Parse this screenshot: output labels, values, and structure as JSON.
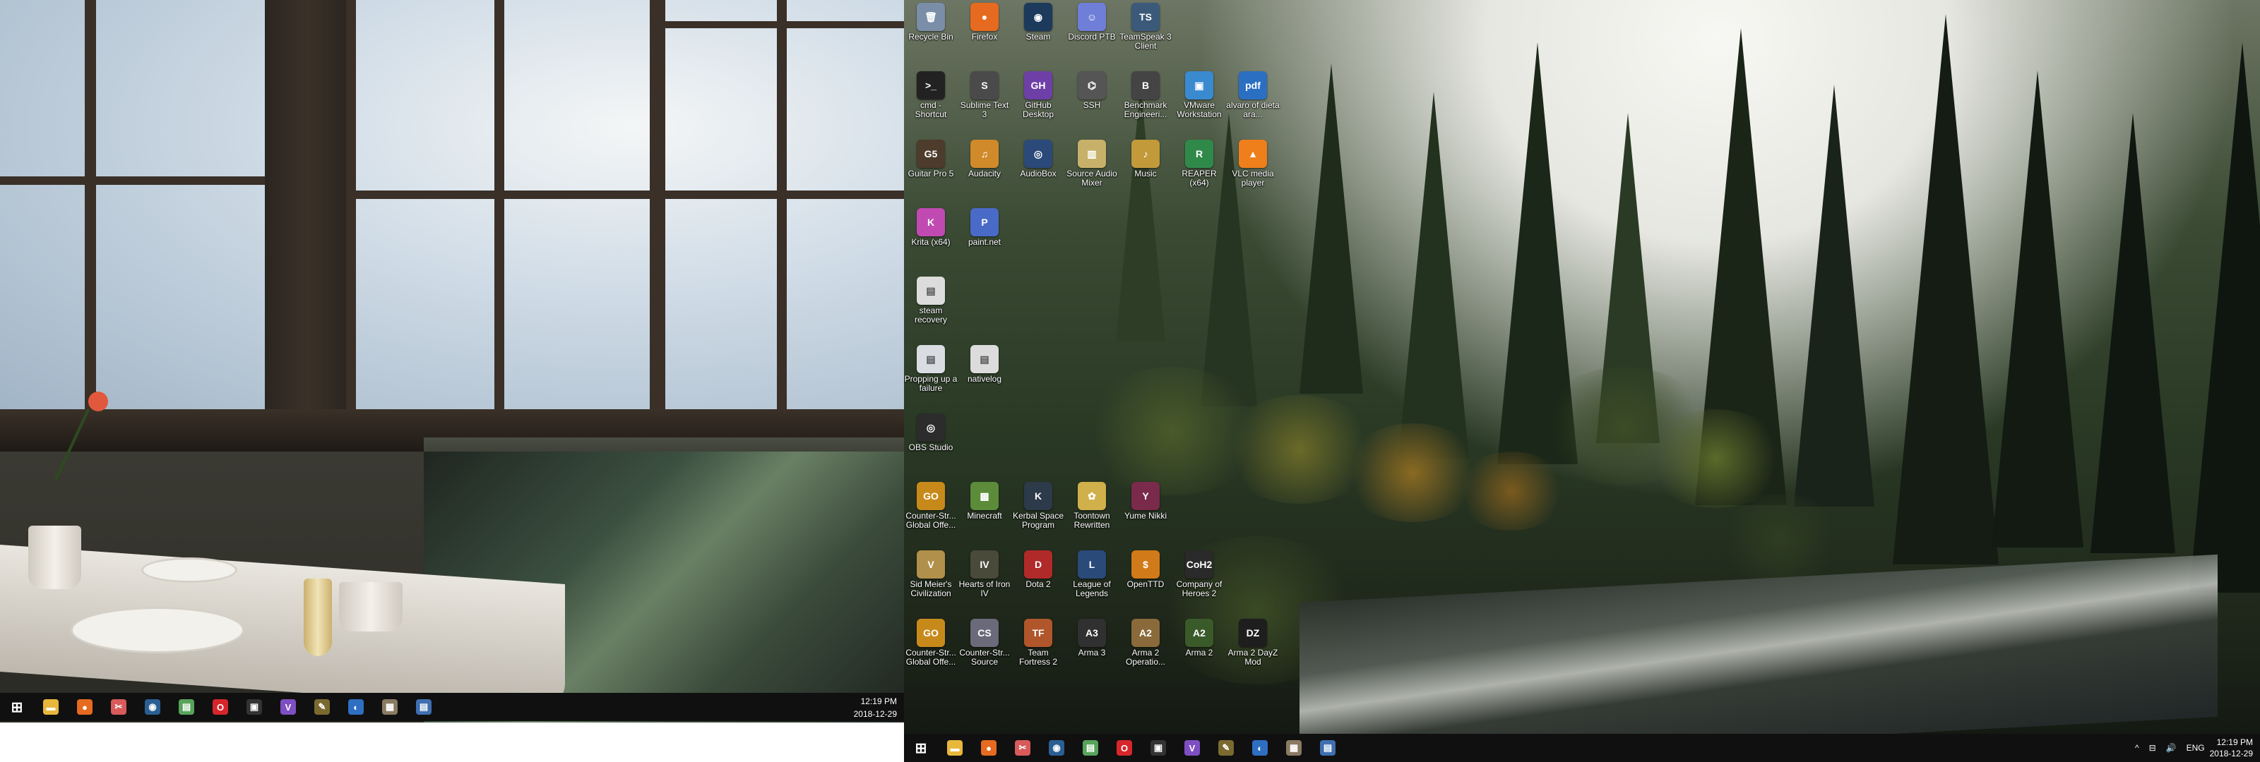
{
  "left_monitor": {
    "taskbar": {
      "items": [
        {
          "name": "start-button",
          "glyph": "⊞",
          "color": "#ffffff"
        },
        {
          "name": "file-explorer-icon",
          "glyph": "▬",
          "color": "#e8b83c"
        },
        {
          "name": "firefox-icon",
          "glyph": "●",
          "color": "#e66a1f"
        },
        {
          "name": "snipping-tool-icon",
          "glyph": "✂",
          "color": "#d85a5a"
        },
        {
          "name": "steam-icon",
          "glyph": "◉",
          "color": "#2a5f93"
        },
        {
          "name": "notepad-icon",
          "glyph": "▤",
          "color": "#57a35a"
        },
        {
          "name": "opera-icon",
          "glyph": "O",
          "color": "#d6262b"
        },
        {
          "name": "terminal-icon",
          "glyph": "▣",
          "color": "#333333"
        },
        {
          "name": "visual-studio-icon",
          "glyph": "V",
          "color": "#7e4fc2"
        },
        {
          "name": "paint-tool-icon",
          "glyph": "✎",
          "color": "#7a6a30"
        },
        {
          "name": "dot-app-icon",
          "glyph": "◐",
          "color": "#2f6fc2"
        },
        {
          "name": "gallery-icon",
          "glyph": "▦",
          "color": "#8a7a62"
        },
        {
          "name": "document-icon",
          "glyph": "▤",
          "color": "#3f6fb0"
        }
      ],
      "clock_time": "12:19 PM",
      "clock_date": "2018-12-29"
    }
  },
  "right_monitor": {
    "desktop_icons": [
      {
        "label": "Recycle Bin",
        "glyph": "🗑",
        "color": "#7a8ea8",
        "col": 0,
        "row": 0
      },
      {
        "label": "Firefox",
        "glyph": "●",
        "color": "#e66a1f",
        "col": 1,
        "row": 0
      },
      {
        "label": "Steam",
        "glyph": "◉",
        "color": "#1b3a5c",
        "col": 2,
        "row": 0
      },
      {
        "label": "Discord PTB",
        "glyph": "☺",
        "color": "#6f7fd8",
        "col": 3,
        "row": 0
      },
      {
        "label": "TeamSpeak 3 Client",
        "glyph": "TS",
        "color": "#3b5a7a",
        "col": 4,
        "row": 0
      },
      {
        "label": "cmd - Shortcut",
        "glyph": ">_",
        "color": "#222222",
        "col": 0,
        "row": 1
      },
      {
        "label": "Sublime Text 3",
        "glyph": "S",
        "color": "#4a4a4a",
        "col": 1,
        "row": 1
      },
      {
        "label": "GitHub Desktop",
        "glyph": "GH",
        "color": "#6e3fa7",
        "col": 2,
        "row": 1
      },
      {
        "label": "SSH",
        "glyph": "⌬",
        "color": "#555555",
        "col": 3,
        "row": 1
      },
      {
        "label": "Benchmark Engineeri...",
        "glyph": "B",
        "color": "#444444",
        "col": 4,
        "row": 1
      },
      {
        "label": "VMware Workstation",
        "glyph": "▣",
        "color": "#3a8ad0",
        "col": 5,
        "row": 1
      },
      {
        "label": "alvaro of dieta ara...",
        "glyph": "pdf",
        "color": "#2a6fc2",
        "col": 6,
        "row": 1
      },
      {
        "label": "Guitar Pro 5",
        "glyph": "G5",
        "color": "#4d3b2b",
        "col": 0,
        "row": 2
      },
      {
        "label": "Audacity",
        "glyph": "♫",
        "color": "#d08a2a",
        "col": 1,
        "row": 2
      },
      {
        "label": "AudioBox",
        "glyph": "◎",
        "color": "#2b4a7a",
        "col": 2,
        "row": 2
      },
      {
        "label": "Source Audio Mixer",
        "glyph": "▥",
        "color": "#c7b16a",
        "col": 3,
        "row": 2
      },
      {
        "label": "Music",
        "glyph": "♪",
        "color": "#c29a3a",
        "col": 4,
        "row": 2
      },
      {
        "label": "REAPER (x64)",
        "glyph": "R",
        "color": "#2f8a4a",
        "col": 5,
        "row": 2
      },
      {
        "label": "VLC media player",
        "glyph": "▲",
        "color": "#ee7f1a",
        "col": 6,
        "row": 2
      },
      {
        "label": "Krita (x64)",
        "glyph": "K",
        "color": "#c04ab2",
        "col": 0,
        "row": 3
      },
      {
        "label": "paint.net",
        "glyph": "P",
        "color": "#4a6ac8",
        "col": 1,
        "row": 3
      },
      {
        "label": "steam recovery",
        "glyph": "▤",
        "color": "#dcdcdc",
        "col": 0,
        "row": 4
      },
      {
        "label": "Propping up a failure",
        "glyph": "▤",
        "color": "#d9dde2",
        "col": 0,
        "row": 5
      },
      {
        "label": "nativelog",
        "glyph": "▤",
        "color": "#dcdcdc",
        "col": 1,
        "row": 5
      },
      {
        "label": "OBS Studio",
        "glyph": "◎",
        "color": "#2c2c2c",
        "col": 0,
        "row": 6
      },
      {
        "label": "Counter-Str... Global Offe...",
        "glyph": "GO",
        "color": "#c78a1a",
        "col": 0,
        "row": 7
      },
      {
        "label": "Minecraft",
        "glyph": "▩",
        "color": "#5c8c3a",
        "col": 1,
        "row": 7
      },
      {
        "label": "Kerbal Space Program",
        "glyph": "K",
        "color": "#2c3a4a",
        "col": 2,
        "row": 7
      },
      {
        "label": "Toontown Rewritten",
        "glyph": "✿",
        "color": "#d0b04a",
        "col": 3,
        "row": 7
      },
      {
        "label": "Yume Nikki",
        "glyph": "Y",
        "color": "#7a2a4a",
        "col": 4,
        "row": 7
      },
      {
        "label": "Sid Meier's Civilization",
        "glyph": "V",
        "color": "#b0904a",
        "col": 0,
        "row": 8
      },
      {
        "label": "Hearts of Iron IV",
        "glyph": "IV",
        "color": "#4a4a3a",
        "col": 1,
        "row": 8
      },
      {
        "label": "Dota 2",
        "glyph": "D",
        "color": "#b02a2a",
        "col": 2,
        "row": 8
      },
      {
        "label": "League of Legends",
        "glyph": "L",
        "color": "#2a4a7a",
        "col": 3,
        "row": 8
      },
      {
        "label": "OpenTTD",
        "glyph": "$",
        "color": "#d07a1a",
        "col": 4,
        "row": 8
      },
      {
        "label": "Company of Heroes 2",
        "glyph": "CoH2",
        "color": "#2a2a2a",
        "col": 5,
        "row": 8
      },
      {
        "label": "Counter-Str... Global Offe...",
        "glyph": "GO",
        "color": "#c78a1a",
        "col": 0,
        "row": 9
      },
      {
        "label": "Counter-Str... Source",
        "glyph": "CS",
        "color": "#6a6a7a",
        "col": 1,
        "row": 9
      },
      {
        "label": "Team Fortress 2",
        "glyph": "TF",
        "color": "#b0562a",
        "col": 2,
        "row": 9
      },
      {
        "label": "Arma 3",
        "glyph": "A3",
        "color": "#303030",
        "col": 3,
        "row": 9
      },
      {
        "label": "Arma 2 Operatio...",
        "glyph": "A2",
        "color": "#8a6a3a",
        "col": 4,
        "row": 9
      },
      {
        "label": "Arma 2",
        "glyph": "A2",
        "color": "#3a5a2a",
        "col": 5,
        "row": 9
      },
      {
        "label": "Arma 2 DayZ Mod",
        "glyph": "DZ",
        "color": "#1e1e1e",
        "col": 6,
        "row": 9
      }
    ],
    "taskbar": {
      "items": [
        {
          "name": "start-button",
          "glyph": "⊞",
          "color": "#ffffff"
        },
        {
          "name": "file-explorer-icon",
          "glyph": "▬",
          "color": "#e8b83c"
        },
        {
          "name": "firefox-icon",
          "glyph": "●",
          "color": "#e66a1f"
        },
        {
          "name": "snipping-tool-icon",
          "glyph": "✂",
          "color": "#d85a5a"
        },
        {
          "name": "steam-icon",
          "glyph": "◉",
          "color": "#2a5f93"
        },
        {
          "name": "notepad-icon",
          "glyph": "▤",
          "color": "#57a35a"
        },
        {
          "name": "opera-icon",
          "glyph": "O",
          "color": "#d6262b"
        },
        {
          "name": "terminal-icon",
          "glyph": "▣",
          "color": "#333333"
        },
        {
          "name": "visual-studio-icon",
          "glyph": "V",
          "color": "#7e4fc2"
        },
        {
          "name": "paint-tool-icon",
          "glyph": "✎",
          "color": "#7a6a30"
        },
        {
          "name": "dot-app-icon",
          "glyph": "◐",
          "color": "#2f6fc2"
        },
        {
          "name": "gallery-icon",
          "glyph": "▦",
          "color": "#8a7a62"
        },
        {
          "name": "document-icon",
          "glyph": "▤",
          "color": "#3f6fb0"
        }
      ],
      "tray": {
        "chevron": "^",
        "network": "⊟",
        "speaker": "🔊",
        "language": "ENG",
        "clock_time": "12:19 PM",
        "clock_date": "2018-12-29"
      }
    }
  }
}
